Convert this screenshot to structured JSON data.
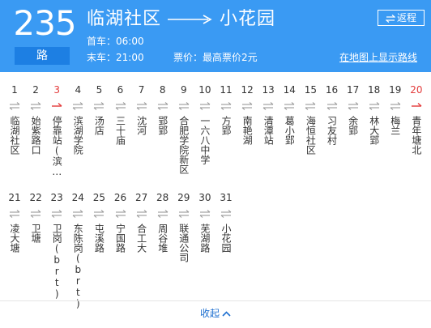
{
  "route": {
    "number": "235",
    "unit": "路",
    "from": "临湖社区",
    "to": "小花园",
    "first_bus": "首车：06:00",
    "last_bus": "末车：21:00",
    "fare": "票价：最高票价2元",
    "reverse_label": "返程",
    "map_link": "在地图上显示路线"
  },
  "stops": [
    {
      "num": "1",
      "name": "临湖社区",
      "dir": "both"
    },
    {
      "num": "2",
      "name": "始紫路口",
      "dir": "both"
    },
    {
      "num": "3",
      "name": "停靠站(滨…",
      "dir": "up"
    },
    {
      "num": "4",
      "name": "滨湖学院",
      "dir": "both"
    },
    {
      "num": "5",
      "name": "汤店",
      "dir": "both"
    },
    {
      "num": "6",
      "name": "三十庙",
      "dir": "both"
    },
    {
      "num": "7",
      "name": "沈河",
      "dir": "both"
    },
    {
      "num": "8",
      "name": "郢郢",
      "dir": "both"
    },
    {
      "num": "9",
      "name": "合肥学院新区",
      "dir": "both"
    },
    {
      "num": "10",
      "name": "一六八中学",
      "dir": "both"
    },
    {
      "num": "11",
      "name": "方郢",
      "dir": "both"
    },
    {
      "num": "12",
      "name": "南艳湖",
      "dir": "both"
    },
    {
      "num": "13",
      "name": "清潭站",
      "dir": "both"
    },
    {
      "num": "14",
      "name": "葛小郢",
      "dir": "both"
    },
    {
      "num": "15",
      "name": "海恒社区",
      "dir": "both"
    },
    {
      "num": "16",
      "name": "习友村",
      "dir": "both"
    },
    {
      "num": "17",
      "name": "余郢",
      "dir": "both"
    },
    {
      "num": "18",
      "name": "林大郢",
      "dir": "both"
    },
    {
      "num": "19",
      "name": "梅兰",
      "dir": "both"
    },
    {
      "num": "20",
      "name": "青年塘北",
      "dir": "up"
    },
    {
      "num": "21",
      "name": "凌大塘",
      "dir": "both"
    },
    {
      "num": "22",
      "name": "卫塘",
      "dir": "both"
    },
    {
      "num": "23",
      "name": "卫岗(brt)",
      "dir": "both"
    },
    {
      "num": "24",
      "name": "东陈岗(brt)",
      "dir": "both"
    },
    {
      "num": "25",
      "name": "屯溪路",
      "dir": "both"
    },
    {
      "num": "26",
      "name": "宁国路",
      "dir": "both"
    },
    {
      "num": "27",
      "name": "合工大",
      "dir": "both"
    },
    {
      "num": "28",
      "name": "周谷堆",
      "dir": "both"
    },
    {
      "num": "29",
      "name": "联通公司",
      "dir": "both"
    },
    {
      "num": "30",
      "name": "芜湖路",
      "dir": "both"
    },
    {
      "num": "31",
      "name": "小花园",
      "dir": "both"
    }
  ],
  "collapse_label": "收起",
  "colors": {
    "header_bg": "#3a9af3",
    "unit_bg": "#1d7fe3",
    "terminal": "#e33b3b",
    "link": "#1d6fd0"
  }
}
